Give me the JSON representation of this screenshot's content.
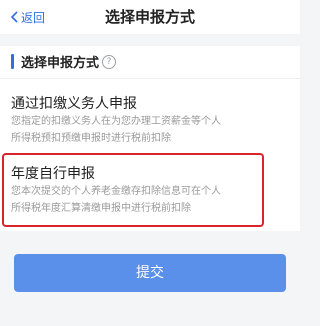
{
  "header": {
    "back_label": "返回",
    "title": "选择申报方式"
  },
  "section": {
    "title": "选择申报方式",
    "help_icon_char": "?"
  },
  "options": [
    {
      "title": "通过扣缴义务人申报",
      "desc_line1": "您指定的扣缴义务人在为您办理工资薪金等个人",
      "desc_line2": "所得税预扣预缴申报时进行税前扣除"
    },
    {
      "title": "年度自行申报",
      "desc_line1": "您本次提交的个人养老金缴存扣除信息可在个人",
      "desc_line2": "所得税年度汇算清缴申报中进行税前扣除",
      "highlighted": true
    }
  ],
  "submit_label": "提交",
  "colors": {
    "accent": "#2f6fe0",
    "button": "#5a8fea",
    "highlight": "#d9242b"
  }
}
